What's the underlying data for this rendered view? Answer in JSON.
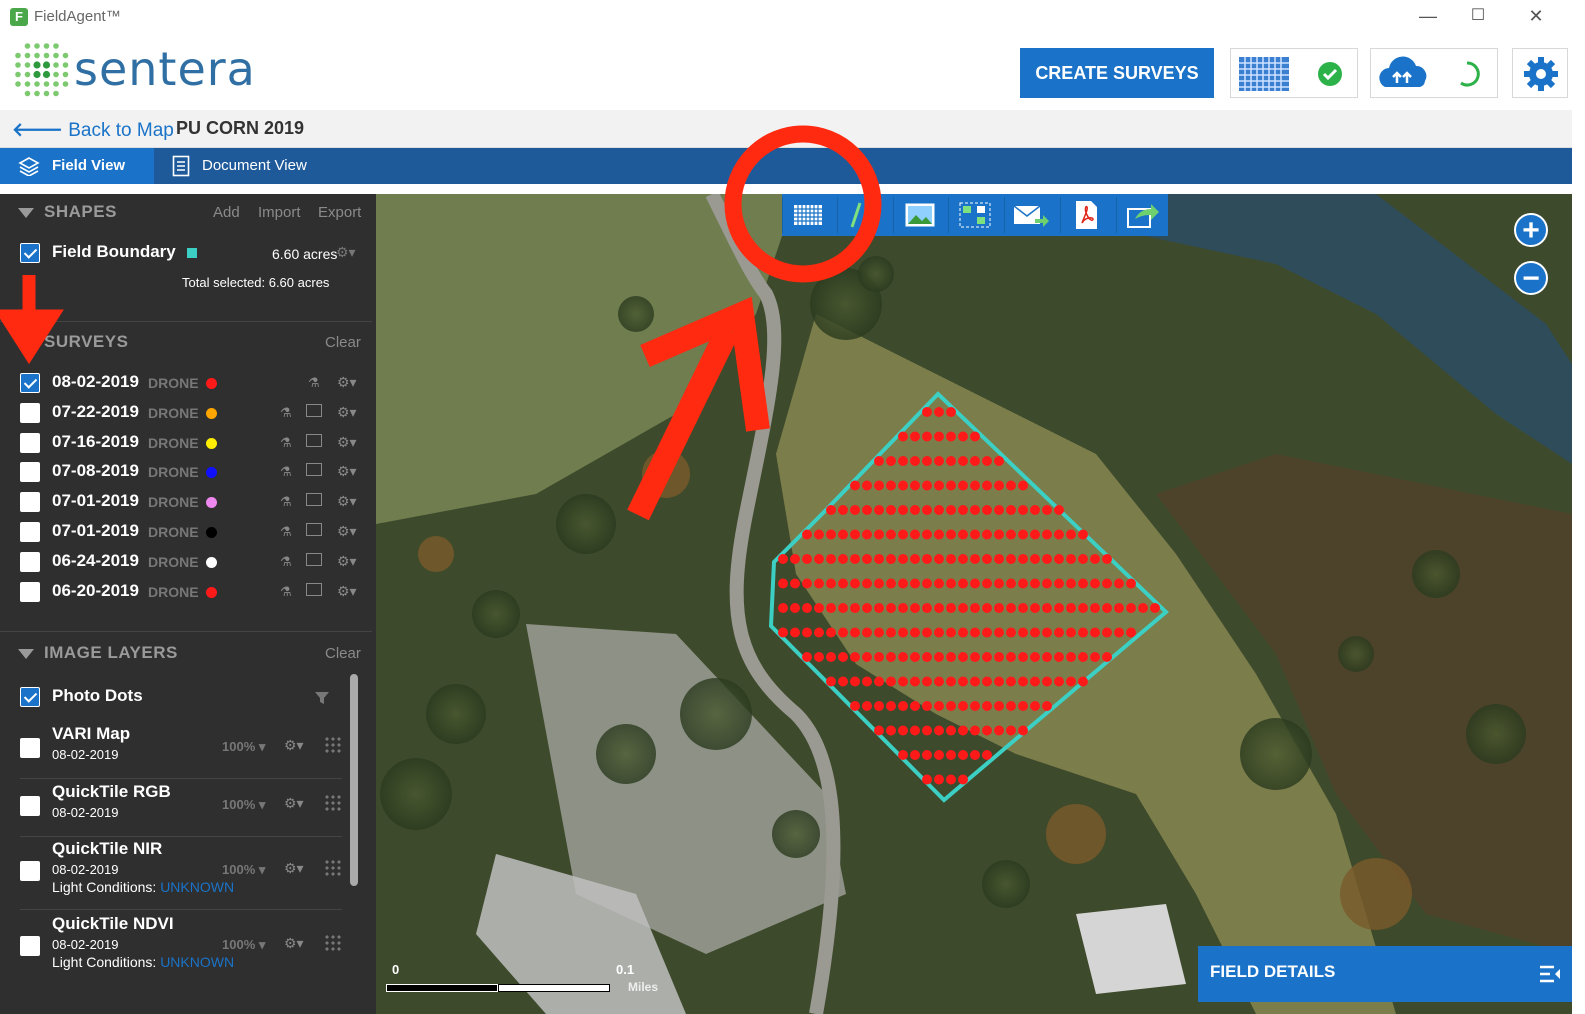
{
  "window": {
    "title": "FieldAgent™",
    "minimize": "—",
    "maximize": "☐",
    "close": "✕"
  },
  "brand": {
    "name": "sentera"
  },
  "header": {
    "create_label": "CREATE SURVEYS"
  },
  "breadcrumb": {
    "back_label": "Back to Map",
    "project": "PU CORN 2019"
  },
  "tabs": [
    {
      "label": "Field View",
      "active": true
    },
    {
      "label": "Document View",
      "active": false
    }
  ],
  "shapes": {
    "title": "SHAPES",
    "add": "Add",
    "import": "Import",
    "export": "Export",
    "boundary": {
      "name": "Field Boundary",
      "area": "6.60 acres",
      "color": "#3ccfc4",
      "checked": true
    },
    "total": "Total selected: 6.60 acres"
  },
  "surveys": {
    "title": "SURVEYS",
    "clear": "Clear",
    "items": [
      {
        "date": "08-02-2019",
        "type": "DRONE",
        "color": "#ff1a1a",
        "checked": true
      },
      {
        "date": "07-22-2019",
        "type": "DRONE",
        "color": "#ffa500",
        "checked": false
      },
      {
        "date": "07-16-2019",
        "type": "DRONE",
        "color": "#ffee00",
        "checked": false
      },
      {
        "date": "07-08-2019",
        "type": "DRONE",
        "color": "#1010ff",
        "checked": false
      },
      {
        "date": "07-01-2019",
        "type": "DRONE",
        "color": "#ee88ee",
        "checked": false
      },
      {
        "date": "07-01-2019",
        "type": "DRONE",
        "color": "#000000",
        "checked": false
      },
      {
        "date": "06-24-2019",
        "type": "DRONE",
        "color": "#ffffff",
        "checked": false
      },
      {
        "date": "06-20-2019",
        "type": "DRONE",
        "color": "#ff1a1a",
        "checked": false
      }
    ]
  },
  "image_layers": {
    "title": "IMAGE LAYERS",
    "clear": "Clear",
    "photo_dots": {
      "name": "Photo Dots",
      "checked": true
    },
    "layers": [
      {
        "name": "VARI Map",
        "date": "08-02-2019",
        "opacity": "100%"
      },
      {
        "name": "QuickTile RGB",
        "date": "08-02-2019",
        "opacity": "100%"
      },
      {
        "name": "QuickTile NIR",
        "date": "08-02-2019",
        "opacity": "100%",
        "cond_label": "Light Conditions:",
        "cond_value": "UNKNOWN"
      },
      {
        "name": "QuickTile NDVI",
        "date": "08-02-2019",
        "opacity": "100%",
        "cond_label": "Light Conditions:",
        "cond_value": "UNKNOWN"
      }
    ]
  },
  "map": {
    "zoom_in": "+",
    "zoom_out": "−",
    "scale_left": "0",
    "scale_right": "0.1",
    "scale_unit": "Miles",
    "field_details": "FIELD DETAILS"
  },
  "colors": {
    "accent": "#1a73c8",
    "nav": "#1e5a9a",
    "sidebar": "#2f2f2f",
    "annotation": "#ff2a10"
  }
}
